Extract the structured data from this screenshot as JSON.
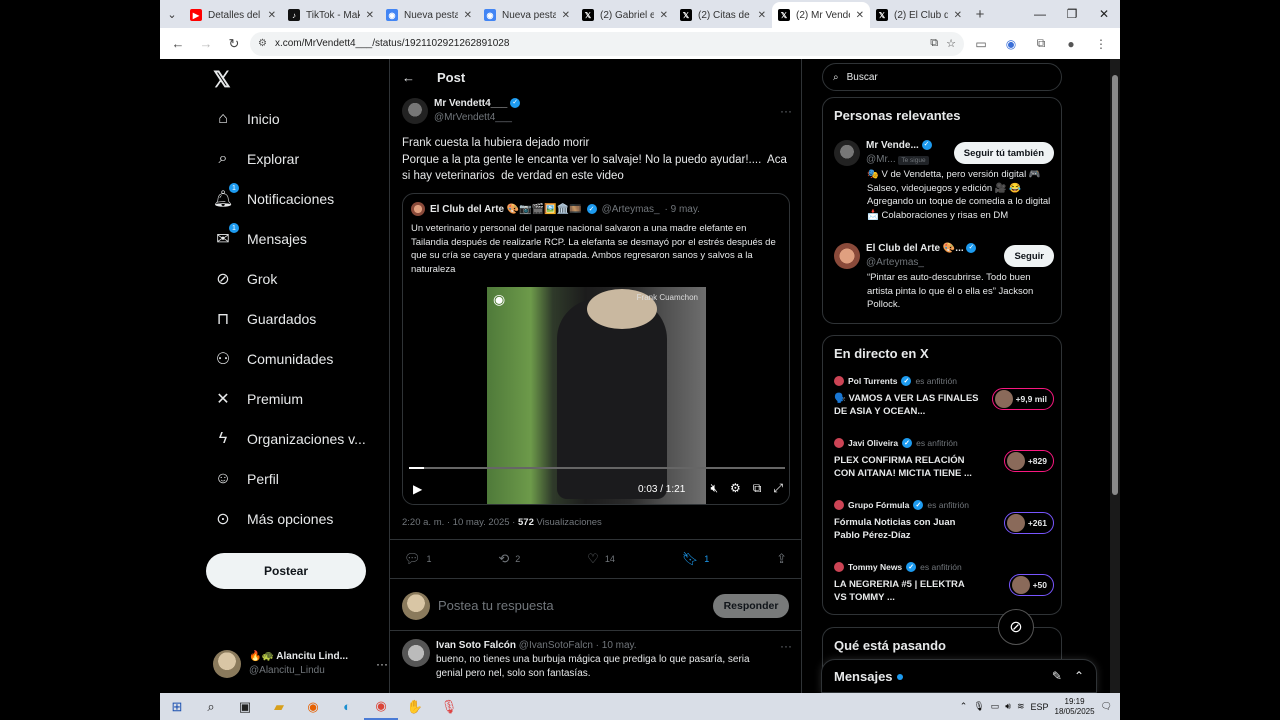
{
  "browser": {
    "tabs": [
      {
        "title": "Detalles del v",
        "fav": "youtube-icon",
        "color": "#ff0000",
        "glyph": "▶"
      },
      {
        "title": "TikTok - Mak",
        "fav": "tiktok-icon",
        "color": "#111111",
        "glyph": "♪"
      },
      {
        "title": "Nueva pestañ",
        "fav": "chrome-icon",
        "color": "#4285f4",
        "glyph": "◉"
      },
      {
        "title": "Nueva pestañ",
        "fav": "chrome-icon",
        "color": "#4285f4",
        "glyph": "◉"
      },
      {
        "title": "(2) Gabriel en",
        "fav": "x-icon",
        "color": "#000000",
        "glyph": "𝕏"
      },
      {
        "title": "(2) Citas de e",
        "fav": "x-icon",
        "color": "#000000",
        "glyph": "𝕏"
      },
      {
        "title": "(2) Mr Vende",
        "fav": "x-icon",
        "color": "#000000",
        "glyph": "𝕏",
        "active": true
      },
      {
        "title": "(2) El Club de",
        "fav": "x-icon",
        "color": "#000000",
        "glyph": "𝕏"
      }
    ],
    "url": "x.com/MrVendett4___/status/1921102921262891028"
  },
  "nav": {
    "items": [
      {
        "label": "Inicio",
        "icon": "home-icon",
        "glyph": "⌂"
      },
      {
        "label": "Explorar",
        "icon": "search-icon",
        "glyph": "⌕"
      },
      {
        "label": "Notificaciones",
        "icon": "bell-icon",
        "glyph": "🔔︎",
        "badge": "1"
      },
      {
        "label": "Mensajes",
        "icon": "mail-icon",
        "glyph": "✉",
        "badge": "1"
      },
      {
        "label": "Grok",
        "icon": "grok-icon",
        "glyph": "⊘"
      },
      {
        "label": "Guardados",
        "icon": "bookmark-icon",
        "glyph": "⊓"
      },
      {
        "label": "Comunidades",
        "icon": "people-icon",
        "glyph": "⚇"
      },
      {
        "label": "Premium",
        "icon": "x-premium-icon",
        "glyph": "✕"
      },
      {
        "label": "Organizaciones v...",
        "icon": "lightning-icon",
        "glyph": "ϟ"
      },
      {
        "label": "Perfil",
        "icon": "person-icon",
        "glyph": "☺"
      },
      {
        "label": "Más opciones",
        "icon": "more-circle-icon",
        "glyph": "⊙"
      }
    ],
    "post_button": "Postear",
    "account": {
      "name": "🔥🐢 Alancitu Lind...",
      "handle": "@Alancitu_Lindu"
    }
  },
  "post": {
    "header": "Post",
    "author": {
      "name": "Mr Vendett4___",
      "handle": "@MrVendett4___"
    },
    "text_lines": [
      "Frank cuesta la hubiera dejado morir",
      "Porque a la pta gente le encanta ver lo salvaje! No la puedo ayudar!....  Aca si hay veterinarios  de verdad en este video"
    ],
    "quote": {
      "name": "El Club del Arte 🎨📷🎬🖼️🏛️🎞️",
      "handle": "@Arteymas_",
      "date": "· 9 may.",
      "text": "Un veterinario y personal del parque nacional salvaron a una madre elefante en Tailandia después de realizarle RCP. La elefanta se desmayó por el estrés después de que su cría se cayera y quedara atrapada. Ambos regresaron sanos y salvos a la naturaleza",
      "video": {
        "watermark": "Frank Cuamchon",
        "time": "0:03 / 1:21",
        "progress": 0.04
      }
    },
    "timestamp": "2:20 a. m. · 10 may. 2025 · ",
    "views_count": "572",
    "views_label": " Visualizaciones",
    "stats": {
      "replies": "1",
      "reposts": "2",
      "likes": "14",
      "bookmarks": "1"
    },
    "reply_placeholder": "Postea tu respuesta",
    "reply_button": "Responder"
  },
  "first_reply": {
    "name": "Ivan Soto Falcón",
    "handle": "@IvanSotoFalcn · 10 may.",
    "text": "bueno, no tienes una burbuja mágica que prediga lo que pasaría, seria genial pero nel, solo son fantasías."
  },
  "right": {
    "search_placeholder": "Buscar",
    "relevant_title": "Personas relevantes",
    "people": [
      {
        "name": "Mr Vende...",
        "handle": "@Mr...",
        "follows_you": "Te sigue",
        "button": "Seguir tú también",
        "bio": "🎭 V de Vendetta, pero versión digital 🎮 Salseo, videojuegos y edición 🎥 😂 Agregando un toque de comedia a lo digital 📩 Colaboraciones y risas en DM"
      },
      {
        "name": "El Club del Arte 🎨...",
        "handle": "@Arteymas_",
        "button": "Seguir",
        "bio": "“Pintar es auto-descubrirse. Todo buen artista pinta lo que él o ella es” Jackson Pollock."
      }
    ],
    "live_title": "En directo en X",
    "live": [
      {
        "host": "Pol Turrents",
        "host_label": "es anfitrión",
        "title": "🗣️ VAMOS A VER LAS FINALES DE ASIA Y OCEAN...",
        "count": "+9,9 mil"
      },
      {
        "host": "Javi Oliveira",
        "host_label": "es anfitrión",
        "title": "PLEX CONFIRMA RELACIÓN CON AITANA! MICTIA TIENE ...",
        "count": "+829"
      },
      {
        "host": "Grupo Fórmula",
        "host_label": "es anfitrión",
        "title": "Fórmula Noticias con Juan Pablo Pérez-Díaz",
        "count": "+261"
      },
      {
        "host": "Tommy News",
        "host_label": "es anfitrión",
        "title": "LA NEGRERIA #5 | ELEKTRA VS TOMMY ...",
        "count": "+50"
      }
    ],
    "trending_title": "Qué está pasando",
    "messages_title": "Mensajes"
  },
  "taskbar": {
    "lang": "ESP",
    "time": "19:19",
    "date": "18/05/2025"
  }
}
